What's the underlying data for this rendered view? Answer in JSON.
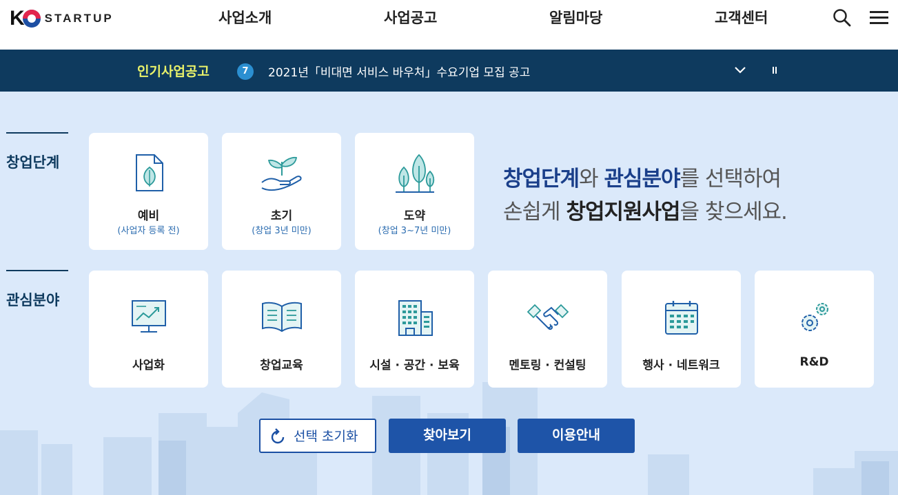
{
  "header": {
    "logo_letter": "K",
    "logo_text": "STARTUP",
    "nav": [
      "사업소개",
      "사업공고",
      "알림마당",
      "고객센터"
    ]
  },
  "ticker": {
    "title": "인기사업공고",
    "number": "7",
    "text": "2021년「비대면 서비스 바우처」수요기업 모집 공고"
  },
  "sections": {
    "stage_label": "창업단계",
    "interest_label": "관심분야"
  },
  "stages": [
    {
      "title": "예비",
      "sub": "(사업자 등록 전)",
      "icon": "document-leaf-icon"
    },
    {
      "title": "초기",
      "sub": "(창업 3년 미만)",
      "icon": "hand-sprout-icon"
    },
    {
      "title": "도약",
      "sub": "(창업 3~7년 미만)",
      "icon": "trees-icon"
    }
  ],
  "interests": [
    {
      "title": "사업화",
      "icon": "chart-board-icon"
    },
    {
      "title": "창업교육",
      "icon": "open-book-icon"
    },
    {
      "title": "시설 · 공간 · 보육",
      "icon": "building-icon"
    },
    {
      "title": "멘토링 · 컨설팅",
      "icon": "handshake-icon"
    },
    {
      "title": "행사 · 네트워크",
      "icon": "calendar-icon"
    },
    {
      "title": "R&D",
      "icon": "gears-icon"
    }
  ],
  "headline": {
    "w1": "창업단계",
    "w2": "와 ",
    "w3": "관심분야",
    "w4": "를 선택하여",
    "w5": "손쉽게 ",
    "w6": "창업지원사업",
    "w7": "을 찾으세요."
  },
  "buttons": {
    "reset": "선택 초기화",
    "find": "찾아보기",
    "guide": "이용안내"
  },
  "colors": {
    "navy": "#0e3a5e",
    "accent_blue": "#1e54a8",
    "ticker_title": "#e9f26a",
    "background": "#dbe9fa"
  }
}
